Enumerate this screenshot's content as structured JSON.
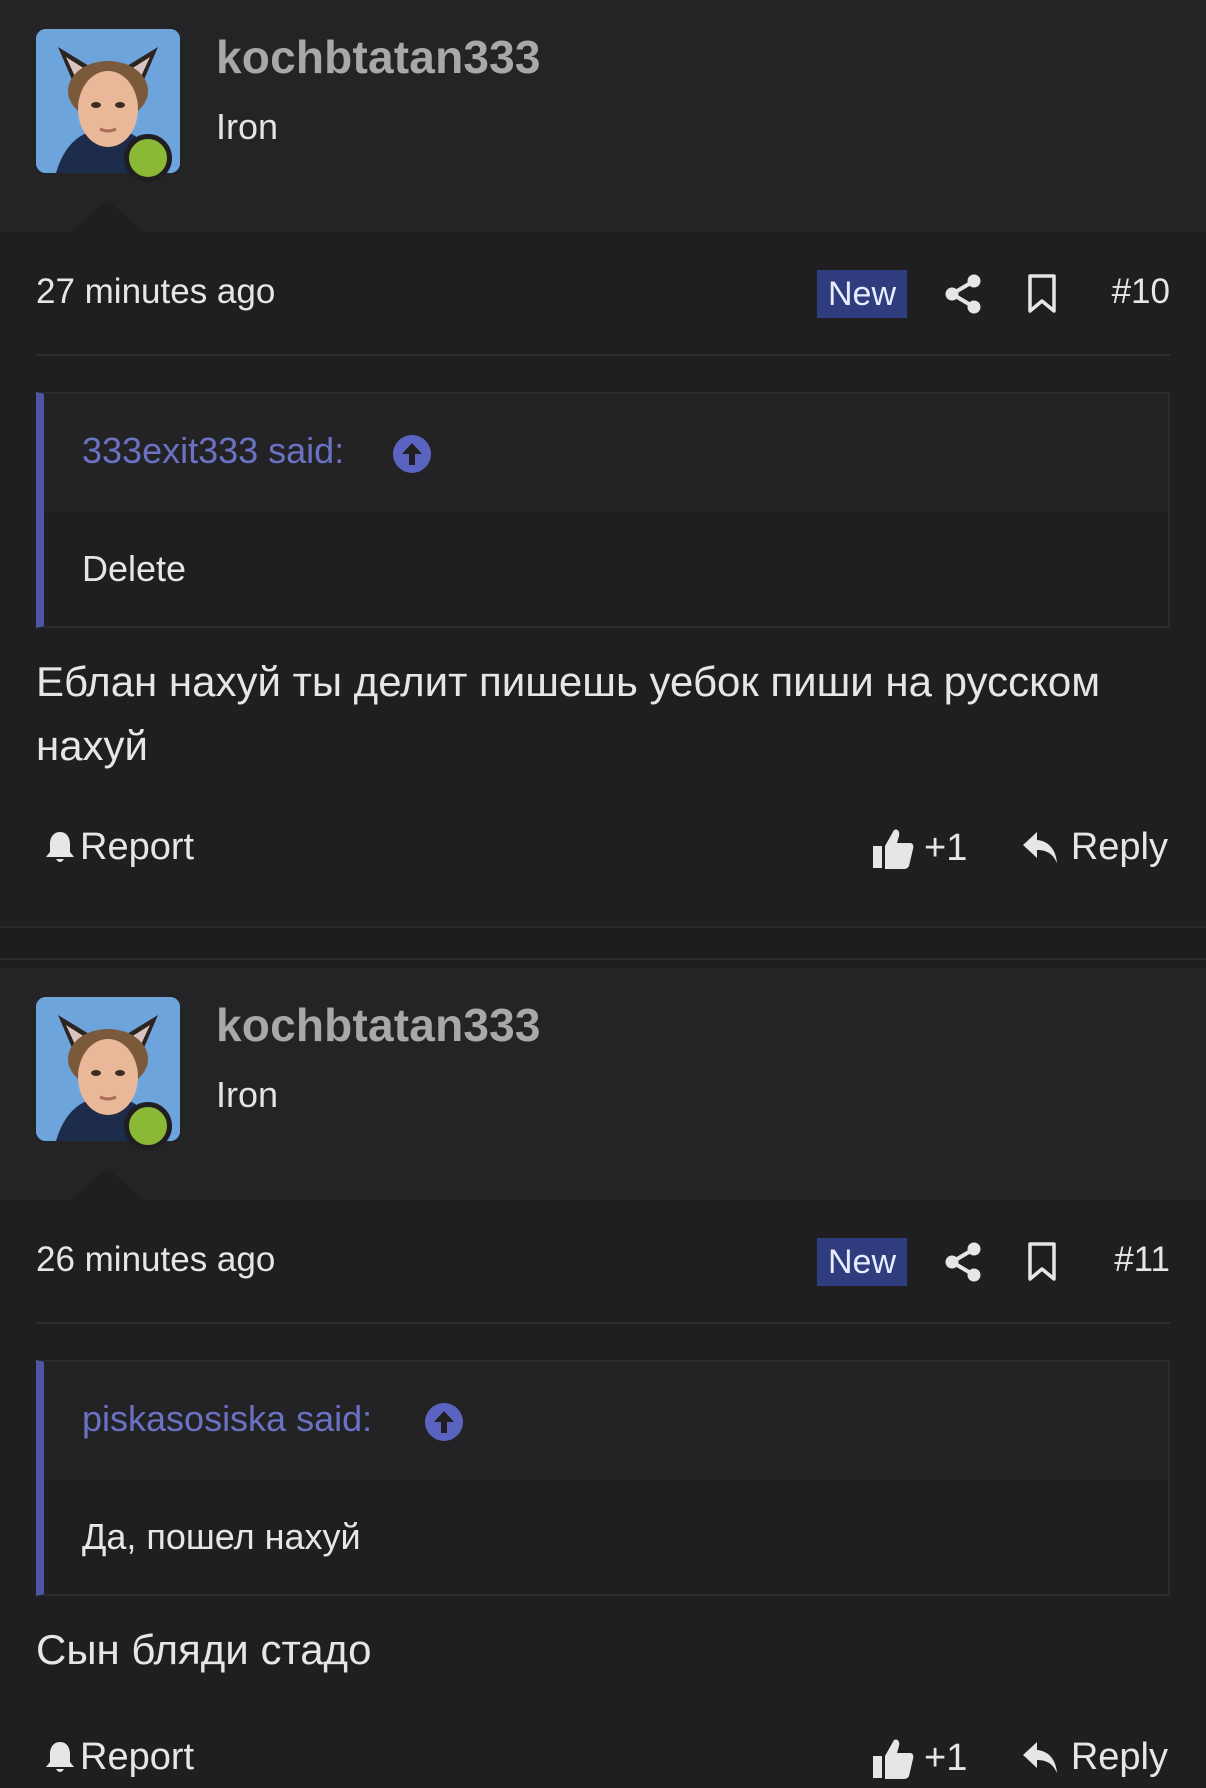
{
  "posts": [
    {
      "username": "kochbtatan333",
      "rank": "Iron",
      "time": "27 minutes ago",
      "badge": "New",
      "number": "#10",
      "quote_author": "333exit333 said:",
      "quote_text": "Delete",
      "message": "Еблан нахуй ты делит пишешь уебок пиши на русском нахуй",
      "report_label": "Report",
      "like_label": "+1",
      "reply_label": "Reply"
    },
    {
      "username": "kochbtatan333",
      "rank": "Iron",
      "time": "26 minutes ago",
      "badge": "New",
      "number": "#11",
      "quote_author": "piskasosiska said:",
      "quote_text": "Да, пошел нахуй",
      "message": "Сын бляди стадо",
      "report_label": "Report",
      "like_label": "+1",
      "reply_label": "Reply"
    }
  ],
  "icons": {
    "share": "share-icon",
    "bookmark": "bookmark-icon",
    "jump_up": "arrow-up-circle-icon",
    "report": "bell-icon",
    "like": "thumbs-up-icon",
    "reply": "reply-arrow-icon"
  },
  "colors": {
    "background": "#1f1f21",
    "online": "#8ab935",
    "badge_bg": "#2f3c7e",
    "quote_accent": "#4f56a8",
    "quote_author": "#6b72c4"
  }
}
